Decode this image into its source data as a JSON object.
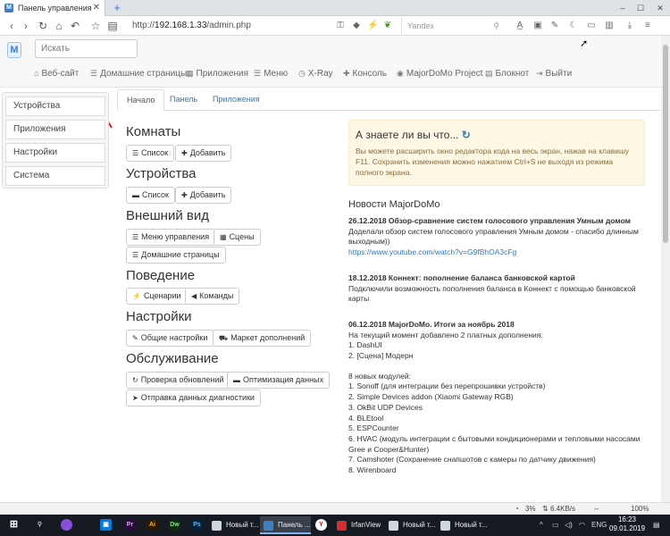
{
  "browser": {
    "tab_title": "Панель управления",
    "favicon_letter": "M",
    "url_prefix": "http://",
    "url_host": "192.168.1.33",
    "url_path": "/admin.php",
    "search_engine": "Yandex",
    "zoom": "100%",
    "status_cpu": "3%",
    "status_net": "6.4KB/s",
    "status_sep": "--"
  },
  "header": {
    "logo_letter": "M",
    "search_placeholder": "Искать",
    "menu": [
      {
        "label": "Веб-сайт",
        "icon": "home-icon"
      },
      {
        "label": "Домашние страницы",
        "icon": "list-icon"
      },
      {
        "label": "Приложения",
        "icon": "grid-icon"
      },
      {
        "label": "Меню",
        "icon": "list-icon"
      },
      {
        "label": "X-Ray",
        "icon": "clock-icon"
      },
      {
        "label": "Консоль",
        "icon": "wrench-icon"
      },
      {
        "label": "MajorDoMo Project",
        "icon": "globe-icon"
      },
      {
        "label": "Блокнот",
        "icon": "notebook-icon"
      },
      {
        "label": "Выйти",
        "icon": "signout-icon"
      }
    ]
  },
  "sidebar": {
    "items": [
      {
        "label": "Устройства"
      },
      {
        "label": "Приложения"
      },
      {
        "label": "Настройки"
      },
      {
        "label": "Система"
      }
    ]
  },
  "tabs": [
    {
      "label": "Начало",
      "active": true
    },
    {
      "label": "Панель",
      "active": false
    },
    {
      "label": "Приложения",
      "active": false
    }
  ],
  "sections": {
    "rooms": {
      "title": "Комнаты",
      "list": "Список",
      "add": "Добавить"
    },
    "devices": {
      "title": "Устройства",
      "list": "Список",
      "add": "Добавить"
    },
    "appearance": {
      "title": "Внешний вид",
      "menu": "Меню управления",
      "scenes": "Сцены",
      "homepages": "Домашние страницы"
    },
    "behavior": {
      "title": "Поведение",
      "scenarios": "Сценарии",
      "commands": "Команды"
    },
    "settings": {
      "title": "Настройки",
      "general": "Общие настройки",
      "market": "Маркет дополнений"
    },
    "maintenance": {
      "title": "Обслуживание",
      "updates": "Проверка обновлений",
      "optimize": "Оптимизация данных",
      "diag": "Отправка данных диагностики"
    }
  },
  "tip": {
    "title": "А знаете ли вы что...",
    "text": "Вы можете расширить окно редактора кода на весь экран, нажав на клавишу F11. Сохранить изменения можно нажатием Ctrl+S не выходя из режима полного экрана."
  },
  "news": {
    "heading": "Новости MajorDoMo",
    "items": [
      {
        "title": "26.12.2018 Обзор-сравнение систем голосового управления Умным домом",
        "text": "Доделали обзор систем голосового управления Умным домом - спасибо длинным выходным))",
        "link": "https://www.youtube.com/watch?v=G9fBhOA3cFg"
      },
      {
        "title": "18.12.2018 Коннект: пополнение баланса банковской картой",
        "text": "Подключили возможность пополнения баланса в Коннект с помощью банковской карты"
      },
      {
        "title": "06.12.2018 MajorDoMo. Итоги за ноябрь 2018",
        "text": "На текущий момент добавлено 2 платных дополнения:",
        "lines1": [
          "1. DashUI",
          "2. [Сцена] Модерн"
        ],
        "intro2": "8 новых модулей:",
        "lines2": [
          "1. Sonoff (для интеграции без перепрошивки устройств)",
          "2. Simple Devices addon (Xiaomi Gateway RGB)",
          "3. OkBit UDP Devices",
          "4. BLEtool",
          "5. ESPCounter",
          "6. HVAC (модуль интеграции с бытовыми кондиционерами и тепловыми насосами Gree и Cooper&Hunter)",
          "7. Camshoter (Сохранение снапшотов с камеры по датчику движения)",
          "8. Wirenboard"
        ]
      }
    ]
  },
  "taskbar": {
    "tasks": [
      "Новый т...",
      "Панель ...",
      "IrfanView",
      "Новый т...",
      "Новый т..."
    ],
    "lang": "ENG",
    "time": "16:23",
    "date": "09.01.2019"
  },
  "colors": {
    "link": "#337ab7",
    "alert_bg": "#fcf8e3",
    "alert_text": "#8a6d3b",
    "annotation_arrow": "#c62828"
  }
}
